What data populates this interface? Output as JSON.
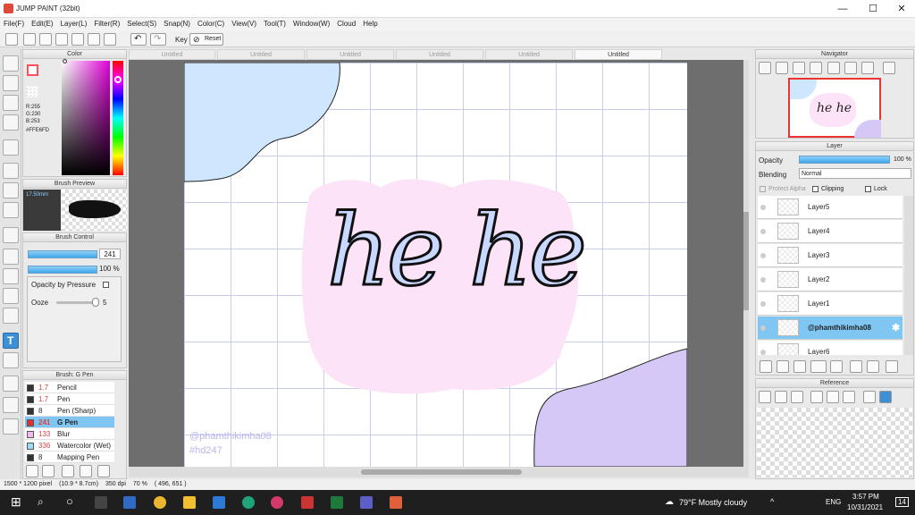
{
  "window": {
    "title": "JUMP PAINT (32bit)",
    "min": "—",
    "max": "☐",
    "close": "✕"
  },
  "menu": [
    "File(F)",
    "Edit(E)",
    "Layer(L)",
    "Filter(R)",
    "Select(S)",
    "Snap(N)",
    "Color(C)",
    "View(V)",
    "Tool(T)",
    "Window(W)",
    "Cloud",
    "Help"
  ],
  "toolbar": {
    "key_label": "Key",
    "reset_label": "Reset"
  },
  "tabs": [
    "Untitled",
    "Untitled",
    "Untitled",
    "Untitled",
    "Untitled",
    "Untitled"
  ],
  "color_panel": {
    "title": "Color",
    "r": "R:255",
    "g": "G:230",
    "b": "B:253",
    "hex": "#FFE6FD",
    "primary": "#ff4f5a",
    "secondary": "#ffffff"
  },
  "brush_preview": {
    "title": "Brush Preview",
    "size": "17.50mm"
  },
  "brush_control": {
    "title": "Brush Control",
    "size_value": "241",
    "opacity_value": "100 %",
    "opacity_pressure": "Opacity by Pressure",
    "ooze_label": "Ooze",
    "ooze_value": "5"
  },
  "brush_list": {
    "title": "Brush: G Pen",
    "items": [
      {
        "size": "1.7",
        "name": "Pencil",
        "color": "#333333",
        "size_color": "#e04040"
      },
      {
        "size": "1.7",
        "name": "Pen",
        "color": "#333333",
        "size_color": "#e04040"
      },
      {
        "size": "8",
        "name": "Pen (Sharp)",
        "color": "#333333",
        "size_color": "#333333"
      },
      {
        "size": "241",
        "name": "G Pen",
        "color": "#e03030",
        "size_color": "#e04040",
        "selected": true
      },
      {
        "size": "133",
        "name": "Blur",
        "color": "#f5b8f0",
        "size_color": "#e04040"
      },
      {
        "size": "336",
        "name": "Watercolor (Wet)",
        "color": "#9adcf5",
        "size_color": "#e04040"
      },
      {
        "size": "8",
        "name": "Mapping Pen",
        "color": "#333333",
        "size_color": "#333333"
      }
    ]
  },
  "canvas": {
    "text": "he he",
    "watermark_line1": "@phamthikimha08",
    "watermark_line2": "#hd247"
  },
  "navigator": {
    "title": "Navigator"
  },
  "layer_panel": {
    "title": "Layer",
    "opacity_label": "Opacity",
    "opacity_value": "100 %",
    "blending_label": "Blending",
    "blending_value": "Normal",
    "protect_alpha": "Protect Alpha",
    "clipping": "Clipping",
    "lock": "Lock",
    "layers": [
      "Layer5",
      "Layer4",
      "Layer3",
      "Layer2",
      "Layer1",
      "@phamthikimha08",
      "Layer6"
    ]
  },
  "reference": {
    "title": "Reference"
  },
  "status": {
    "dimensions": "1500 * 1200 pixel",
    "physical": "(10.9 * 8.7cm)",
    "dpi": "350 dpi",
    "zoom": "70 %",
    "coords": "( 496, 651 )"
  },
  "taskbar": {
    "weather": "79°F Mostly cloudy",
    "lang": "ENG",
    "time": "3:57 PM",
    "date": "10/31/2021",
    "notif": "14"
  }
}
